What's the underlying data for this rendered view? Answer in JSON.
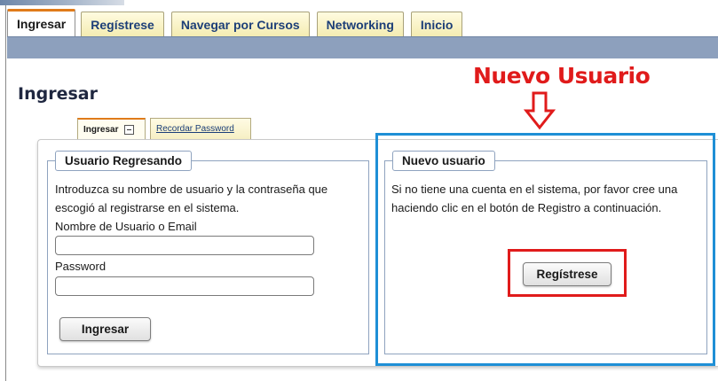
{
  "nav": {
    "tabs": [
      {
        "label": "Ingresar",
        "active": true
      },
      {
        "label": "Regístrese",
        "active": false
      },
      {
        "label": "Navegar por Cursos",
        "active": false
      },
      {
        "label": "Networking",
        "active": false
      },
      {
        "label": "Inicio",
        "active": false
      }
    ]
  },
  "page": {
    "title": "Ingresar"
  },
  "annotation": {
    "text": "Nuevo Usuario",
    "arrow_icon": "down-arrow-icon",
    "color": "#e01b1b",
    "box_color": "#1e8fd6"
  },
  "subtabs": {
    "active_label": "Ingresar",
    "active_icon": "minus-box-icon",
    "inactive_label": "Recordar Password"
  },
  "returning_user": {
    "legend": "Usuario Regresando",
    "intro_line1": "Introduzca su nombre de usuario y la contraseña que",
    "intro_line2": "escogió al registrarse en el sistema.",
    "username_label": "Nombre de Usuario o Email",
    "username_value": "",
    "password_label": "Password",
    "password_value": "",
    "submit_label": "Ingresar"
  },
  "new_user": {
    "legend": "Nuevo usuario",
    "text_line1": "Si no tiene una cuenta en el sistema, por favor cree una",
    "text_line2": "haciendo clic en el botón de Registro a continuación.",
    "register_label": "Regístrese"
  },
  "colors": {
    "tab_accent": "#e07b1a",
    "nav_band": "#8da0bd",
    "link": "#1d3f78"
  }
}
